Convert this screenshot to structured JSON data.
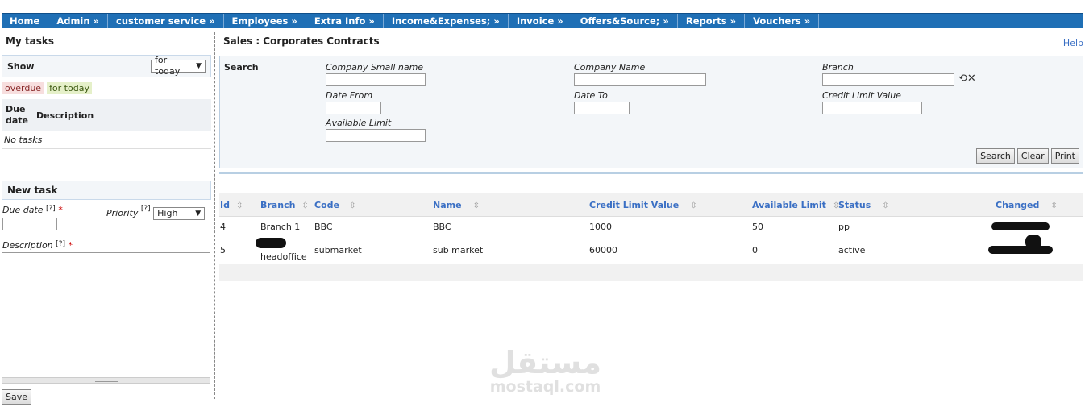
{
  "menu": [
    "Home",
    "Admin »",
    "customer service »",
    "Employees »",
    "Extra Info »",
    "Income&Expenses; »",
    "Invoice »",
    "Offers&Source; »",
    "Reports »",
    "Vouchers »"
  ],
  "left": {
    "title": "My tasks",
    "show_label": "Show",
    "show_value": "for today",
    "badge_overdue": "overdue",
    "badge_today": "for today",
    "col_due_1": "Due",
    "col_due_2": "date",
    "col_desc": "Description",
    "no_tasks": "No tasks"
  },
  "newtask": {
    "title": "New task",
    "due_label": "Due date",
    "priority_label": "Priority",
    "help": "[?]",
    "required": "*",
    "priority_value": "High",
    "desc_label": "Description",
    "save": "Save"
  },
  "main": {
    "title": "Sales : Corporates Contracts",
    "help": "Help",
    "search": {
      "title": "Search",
      "company_small_name": "Company Small name",
      "company_name": "Company Name",
      "branch": "Branch",
      "date_from": "Date From",
      "date_to": "Date To",
      "credit_limit_value": "Credit Limit Value",
      "available_limit": "Available Limit",
      "btn_search": "Search",
      "btn_clear": "Clear",
      "btn_print": "Print"
    },
    "columns": [
      "Id",
      "Branch",
      "Code",
      "Name",
      "Credit Limit Value",
      "Available Limit",
      "Status",
      "Changed"
    ],
    "rows": [
      {
        "id": "4",
        "branch": "Branch 1",
        "code": "BBC",
        "name": "BBC",
        "credit": "1000",
        "available": "50",
        "status": "pp"
      },
      {
        "id": "5",
        "branch": "headoffice",
        "code": "submarket",
        "name": "sub market",
        "credit": "60000",
        "available": "0",
        "status": "active"
      }
    ]
  },
  "watermark": {
    "arabic": "مستقل",
    "latin": "mostaql.com"
  }
}
